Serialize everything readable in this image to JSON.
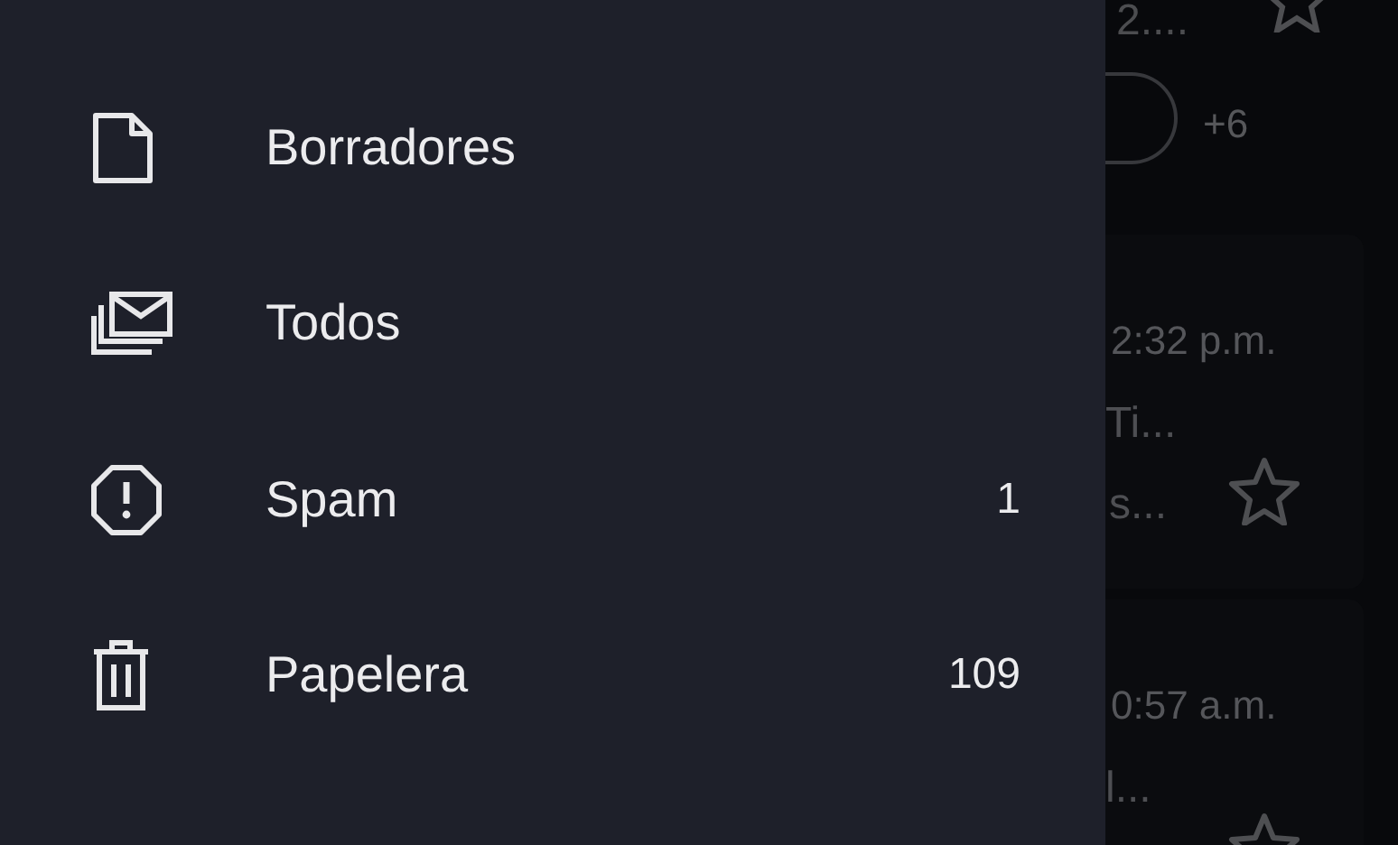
{
  "drawer": {
    "items": [
      {
        "kind": "draft",
        "label": "Borradores",
        "selected": false
      },
      {
        "kind": "all",
        "label": "Todos",
        "selected": false
      },
      {
        "kind": "spam",
        "label": "Spam",
        "count": "1",
        "selected": false
      },
      {
        "kind": "trash",
        "label": "Papelera",
        "count": "109",
        "selected": false
      }
    ]
  },
  "mail_list": {
    "top_fragment": "2....",
    "chip_more": "+6",
    "cards": [
      {
        "time": "2:32 p.m.",
        "line_1": "Ti...",
        "line_2": "s...",
        "starred": false
      },
      {
        "time": "0:57 a.m.",
        "line_1": "l...",
        "starred": false
      }
    ]
  }
}
